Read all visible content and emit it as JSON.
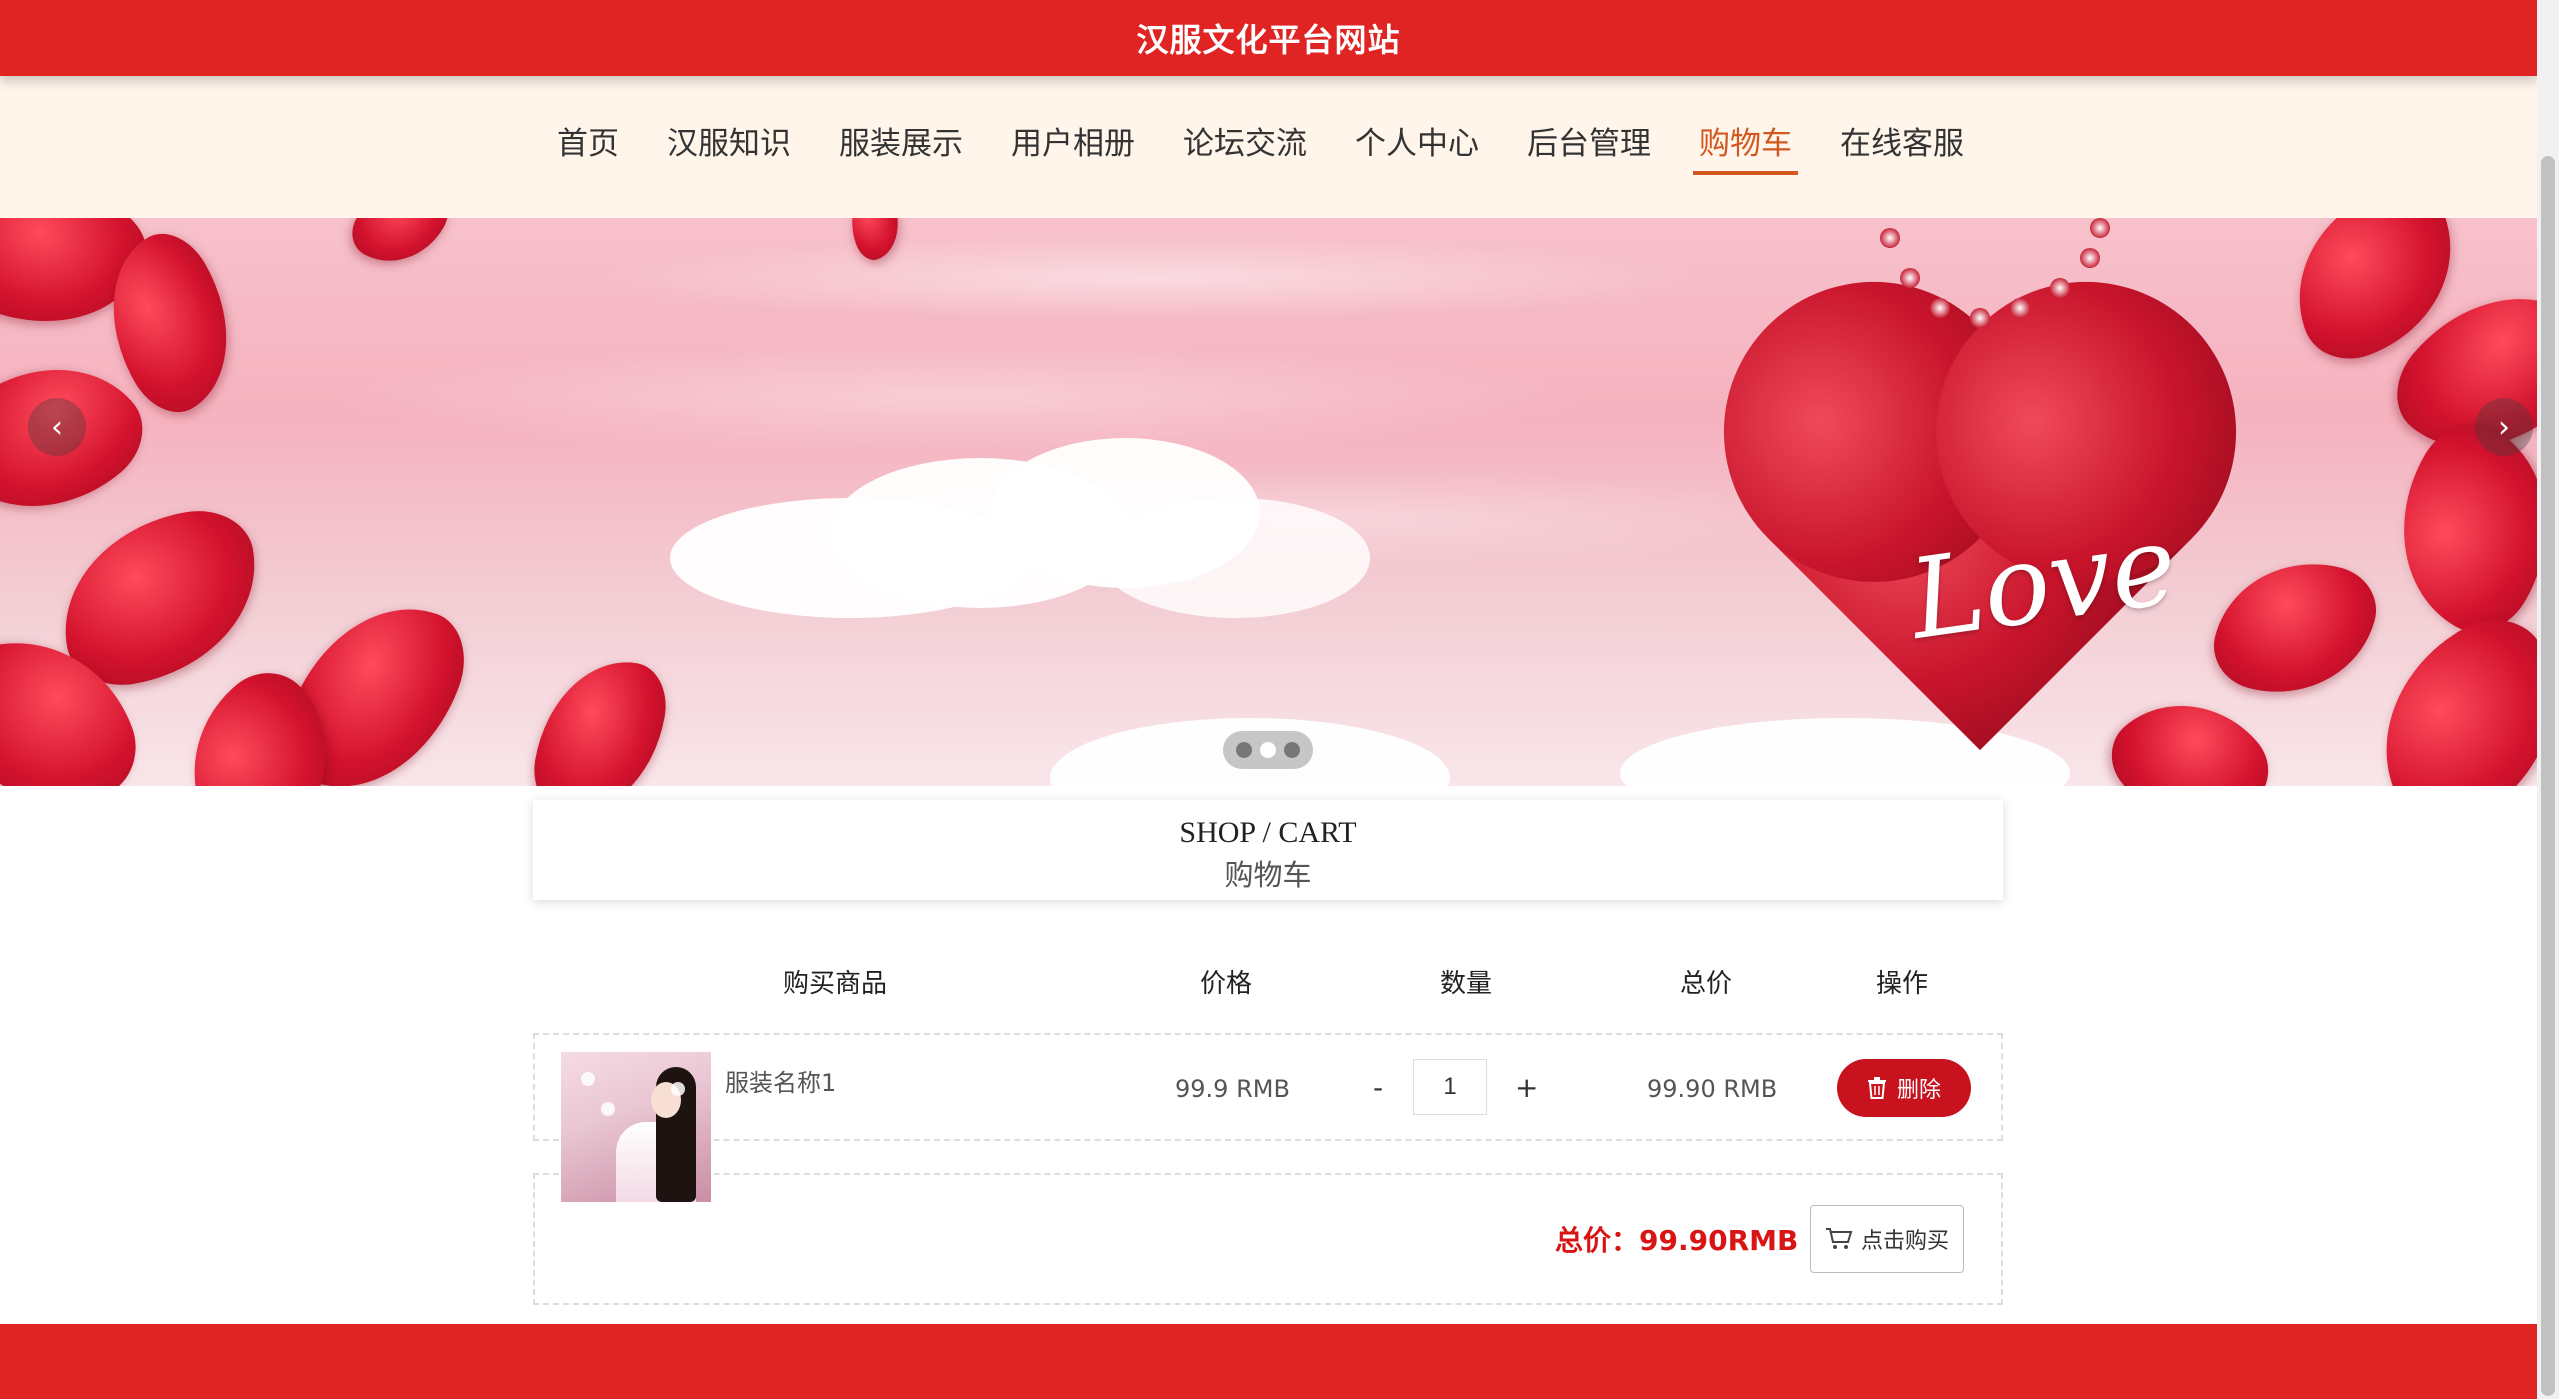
{
  "header": {
    "site_title": "汉服文化平台网站"
  },
  "nav": {
    "items": [
      "首页",
      "汉服知识",
      "服装展示",
      "用户相册",
      "论坛交流",
      "个人中心",
      "后台管理",
      "购物车",
      "在线客服"
    ],
    "active_index": 7
  },
  "banner": {
    "text": "Love",
    "slide_count": 3,
    "active_slide": 1
  },
  "section": {
    "title_en": "SHOP / CART",
    "title_zh": "购物车"
  },
  "cart": {
    "headers": {
      "product": "购买商品",
      "price": "价格",
      "quantity": "数量",
      "total": "总价",
      "action": "操作"
    },
    "items": [
      {
        "name": "服装名称1",
        "price": "99.9 RMB",
        "quantity": "1",
        "total": "99.90 RMB",
        "delete_label": "删除"
      }
    ],
    "qty_minus": "-",
    "qty_plus": "+",
    "summary": "总价：99.90RMB",
    "buy_label": "点击购买"
  },
  "colors": {
    "brand_red": "#e02323",
    "nav_bg": "#fff5eb",
    "active_nav": "#d2581f",
    "delete_red": "#c8121d",
    "total_red": "#d81414"
  }
}
